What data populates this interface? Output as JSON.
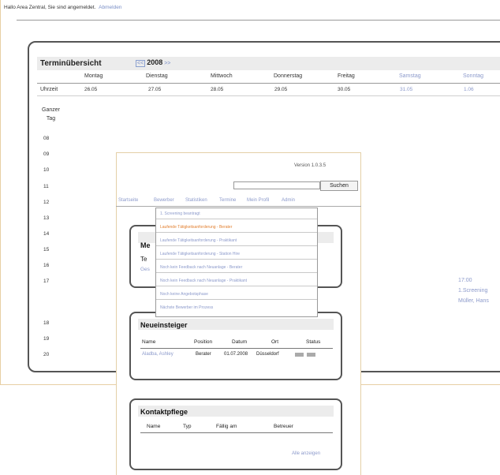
{
  "greeting": {
    "text": "Hallo Area Zentral, Sie sind angemeldet.",
    "logout": "Abmelden"
  },
  "calendar": {
    "title": "Terminübersicht",
    "prev": "<<",
    "year": "2008",
    "next": ">>",
    "uhrzeit_label": "Uhrzeit",
    "ganzer_tag": [
      "Ganzer",
      "Tag"
    ],
    "days": [
      {
        "name": "Montag",
        "date": "26.05",
        "weekend": false
      },
      {
        "name": "Dienstag",
        "date": "27.05",
        "weekend": false
      },
      {
        "name": "Mittwoch",
        "date": "28.05",
        "weekend": false
      },
      {
        "name": "Donnerstag",
        "date": "29.05",
        "weekend": false
      },
      {
        "name": "Freitag",
        "date": "30.05",
        "weekend": false
      },
      {
        "name": "Samstag",
        "date": "31.05",
        "weekend": true
      },
      {
        "name": "Sonntag",
        "date": "1.06",
        "weekend": true
      }
    ],
    "hours": [
      "08",
      "09",
      "10",
      "11",
      "12",
      "13",
      "14",
      "15",
      "16",
      "17",
      "18",
      "19",
      "20"
    ],
    "event": [
      "17:00",
      "1.Screening",
      "Müller, Hans"
    ]
  },
  "popup": {
    "version_label": "Version",
    "version_value": "1.0.3.5",
    "search_placeholder": "",
    "search_button": "Suchen",
    "menu": [
      "Startseite",
      "Bewerber",
      "Statistiken",
      "Termine",
      "Mein Profil",
      "Admin"
    ],
    "panel1": {
      "title": "Me",
      "sub": "Te",
      "link": "Ges"
    },
    "panel2": {
      "title": "Neueinsteiger",
      "columns": [
        "Name",
        "Position",
        "Datum",
        "Ort",
        "Status"
      ],
      "row": {
        "name": "Aladba, Ashley",
        "position": "Berater",
        "date": "01.07.2008",
        "ort": "Düsseldorf"
      }
    },
    "panel3": {
      "title": "Kontaktpflege",
      "columns": [
        "Name",
        "Typ",
        "Fällig am",
        "Betreuer"
      ],
      "link": "Alle anzeigen"
    },
    "dropdown": [
      "1. Screening beantragt",
      "Laufende Tätigkeitsanforderung - Berater",
      "Laufende Tätigkeitsanforderung - Praktikant",
      "Laufende Tätigkeitsanforderung - Station Hire",
      "Noch kein Feedback nach Neuanlage - Berater",
      "Noch kein Feedback nach Neuanlage - Praktikant",
      "Noch keine Angebotsphase",
      "Nächste Bewerber im Prozess"
    ]
  }
}
